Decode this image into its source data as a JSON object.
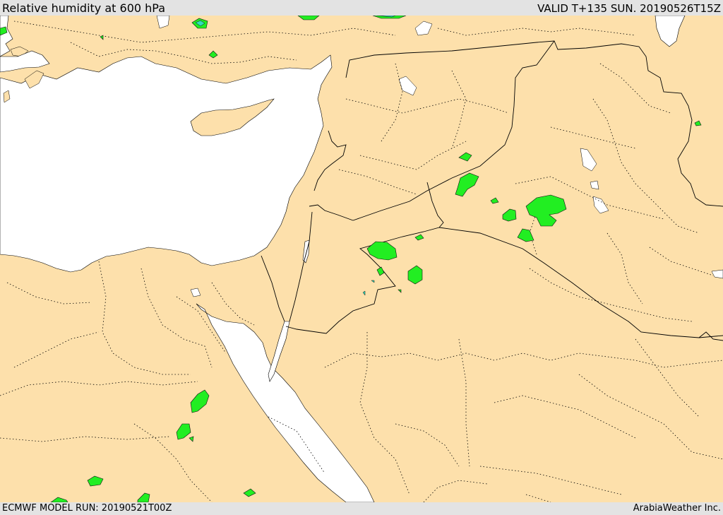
{
  "header": {
    "title": "Relative humidity at 600 hPa",
    "valid": "VALID T+135 SUN. 20190526T15Z"
  },
  "footer": {
    "model_run": "ECMWF MODEL RUN: 20190521T00Z",
    "credit": "ArabiaWeather Inc."
  },
  "colors": {
    "land": "#fde0ab",
    "water": "#ffffff",
    "humidity_high": "#22ee22",
    "humidity_very_high": "#33ddbb",
    "border": "#000000",
    "bar": "#e3e3e3"
  }
}
